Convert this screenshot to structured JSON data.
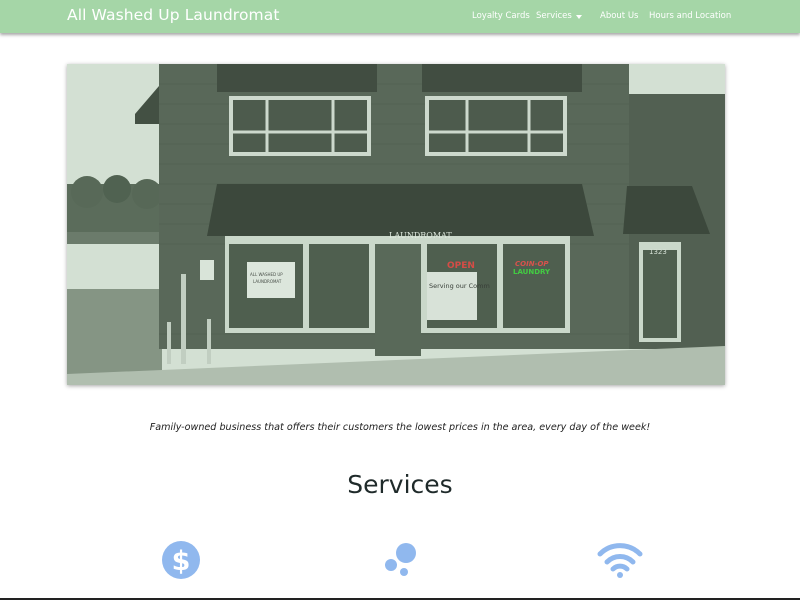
{
  "brand": "All Washed Up Laundromat",
  "nav": {
    "loyalty": "Loyalty Cards",
    "services": "Services",
    "about": "About Us",
    "hours": "Hours and Location"
  },
  "hero": {
    "sign": "LAUNDROMAT",
    "open_sign": "OPEN",
    "coin_sign": "COIN-OP",
    "laundry_sign": "LAUNDRY",
    "address": "1323",
    "window_sign_1": "ALL WASHED UP",
    "window_sign_2": "LAUNDROMAT",
    "serving_sign": "Serving our Comm"
  },
  "tagline": "Family-owned business that offers their customers the lowest prices in the area, every day of the week!",
  "services": {
    "title": "Services",
    "icons": [
      "dollar-icon",
      "bubbles-icon",
      "wifi-icon"
    ],
    "icon_color": "#90b8ee"
  },
  "colors": {
    "navbar": "#a5d6a7",
    "hero_tint": "#9ec49f"
  }
}
